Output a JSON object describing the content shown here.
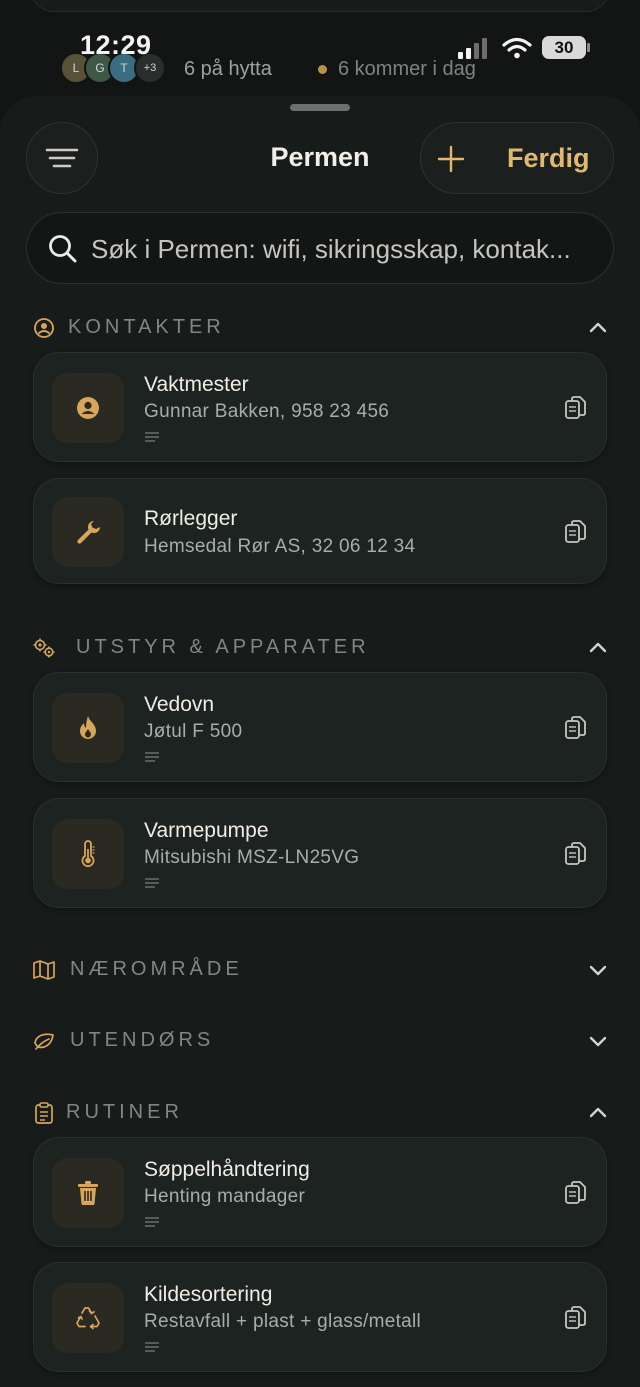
{
  "status": {
    "time": "12:29",
    "battery": "30"
  },
  "presence": {
    "avatars": [
      {
        "letter": "L"
      },
      {
        "letter": "G"
      },
      {
        "letter": "T"
      },
      {
        "letter": "+3"
      }
    ],
    "text": "6 på hytta",
    "arriving": "6 kommer i dag"
  },
  "header": {
    "title": "Permen",
    "done_label": "Ferdig"
  },
  "search": {
    "placeholder": "Søk i Permen: wifi, sikringsskap, kontak..."
  },
  "sections": {
    "kontakter": {
      "label": "KONTAKTER",
      "items": [
        {
          "title": "Vaktmester",
          "subtitle": "Gunnar Bakken, 958 23 456",
          "icon": "person-icon"
        },
        {
          "title": "Rørlegger",
          "subtitle": "Hemsedal Rør AS, 32 06 12 34",
          "icon": "wrench-icon"
        }
      ]
    },
    "utstyr": {
      "label": "UTSTYR & APPARATER",
      "items": [
        {
          "title": "Vedovn",
          "subtitle": "Jøtul F 500",
          "icon": "flame-icon"
        },
        {
          "title": "Varmepumpe",
          "subtitle": "Mitsubishi MSZ-LN25VG",
          "icon": "thermometer-icon"
        }
      ]
    },
    "naeromrade": {
      "label": "NÆROMRÅDE"
    },
    "utendors": {
      "label": "UTENDØRS"
    },
    "rutiner": {
      "label": "RUTINER",
      "items": [
        {
          "title": "Søppelhåndtering",
          "subtitle": "Henting mandager",
          "icon": "trash-icon"
        },
        {
          "title": "Kildesortering",
          "subtitle": "Restavfall + plast + glass/metall",
          "icon": "recycle-icon"
        }
      ]
    }
  },
  "colors": {
    "accent": "#e0b86f",
    "background": "#121514",
    "card": "#1d2320"
  }
}
